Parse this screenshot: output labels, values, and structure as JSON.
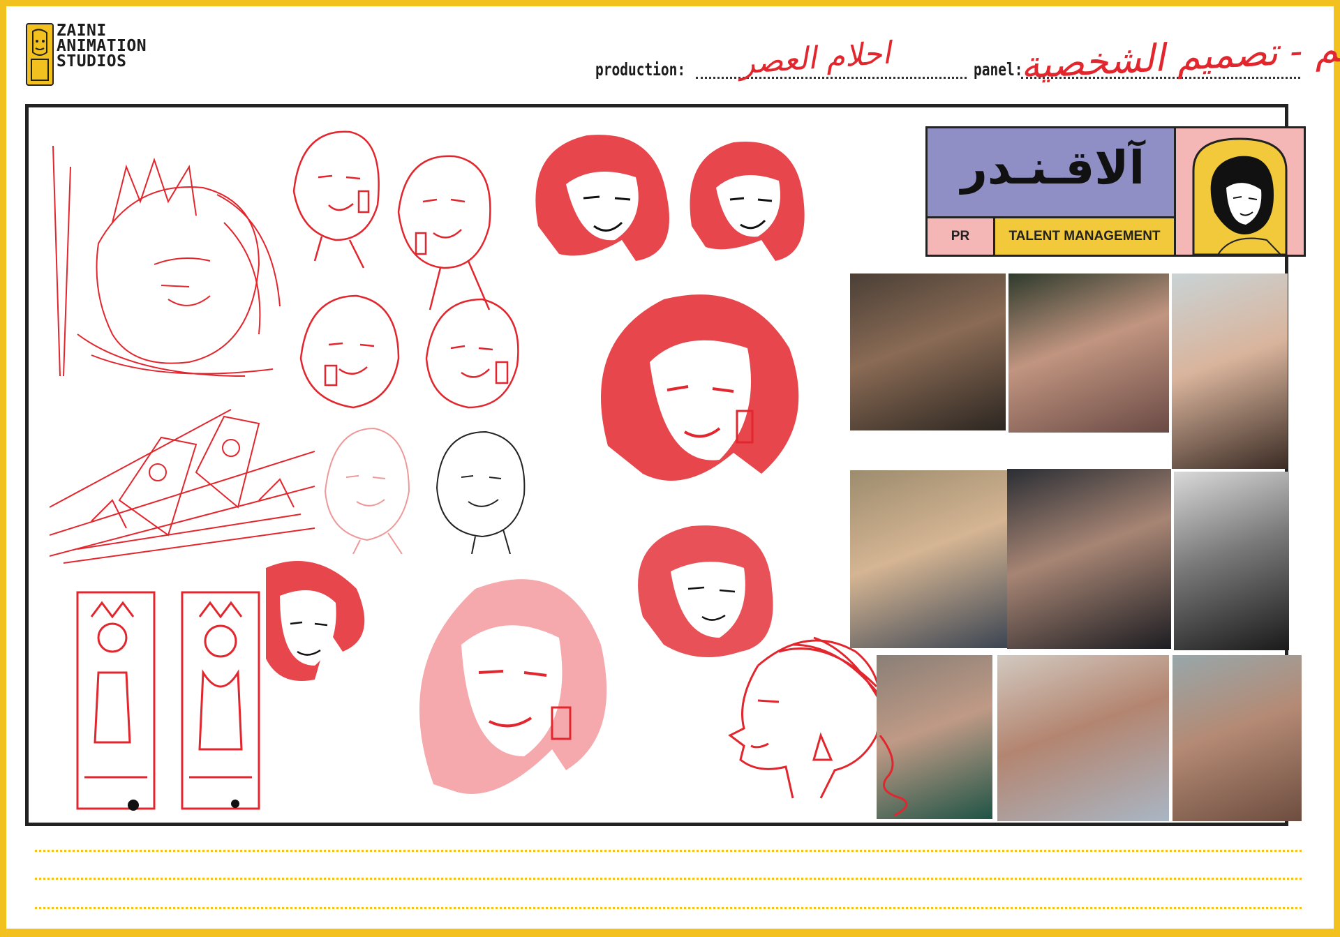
{
  "studio": {
    "logo_lines": [
      "ZAINI",
      "ANIMATION",
      "STUDIOS"
    ]
  },
  "header": {
    "production_label": "production:",
    "production_value": "احلام العصر",
    "panel_label": "panel:",
    "panel_value": "حكيم - تصميم الشخصية"
  },
  "brand_card": {
    "name": "آلاقـنـدر",
    "tag_pr": "PR",
    "tag_talent": "TALENT MANAGEMENT",
    "colors": {
      "purple": "#8f8fc6",
      "pink": "#f4b7b6",
      "yellow": "#f2c93a"
    }
  },
  "colors": {
    "frame": "#f2c01f",
    "sketch_red": "#e2262d",
    "handwriting": "#e2262d"
  },
  "reference_photos": [
    {
      "name": "photo-1"
    },
    {
      "name": "photo-2"
    },
    {
      "name": "photo-3"
    },
    {
      "name": "photo-4"
    },
    {
      "name": "photo-5"
    },
    {
      "name": "photo-6"
    },
    {
      "name": "photo-7"
    },
    {
      "name": "photo-8"
    },
    {
      "name": "photo-9"
    }
  ],
  "note_lines_count": 3
}
